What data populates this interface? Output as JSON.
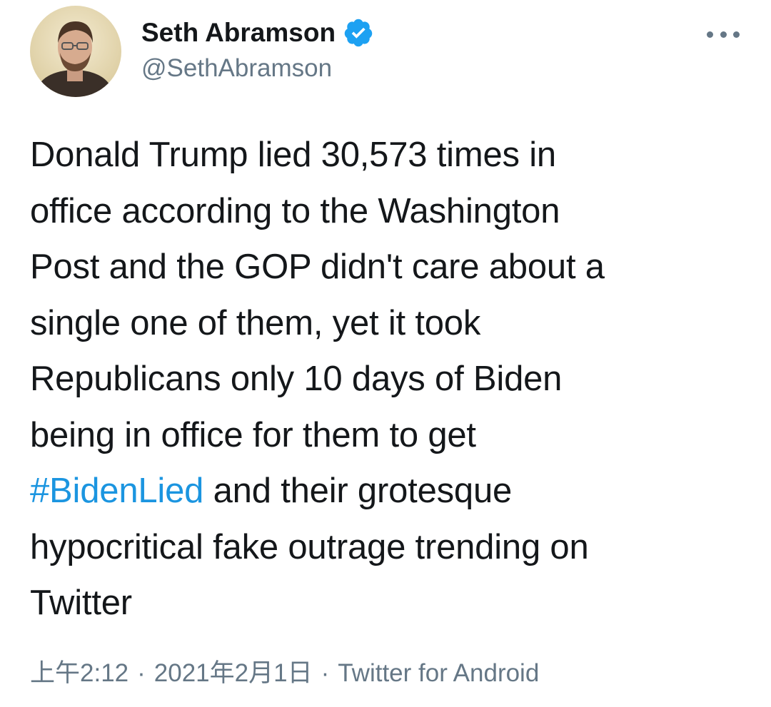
{
  "tweet": {
    "author": {
      "name": "Seth Abramson",
      "handle": "@SethAbramson",
      "verified": true,
      "avatar_icon": "avatar-photo"
    },
    "more_icon": "more-horizontal-icon",
    "text_lines": [
      "Donald Trump lied 30,573 times in",
      "office according to the Washington",
      "Post and the GOP didn't care about a",
      "single one of them, yet it took",
      "Republicans only 10 days of Biden",
      "being in office for them to get"
    ],
    "hashtag": "#BidenLied",
    "line_after_hashtag": " and their grotesque",
    "text_lines_end": [
      "hypocritical fake outrage trending on",
      "Twitter"
    ],
    "meta": {
      "time": "上午2:12",
      "separator": "·",
      "date": "2021年2月1日",
      "source": "Twitter for Android"
    },
    "colors": {
      "link": "#1b95e0",
      "secondary_text": "#657786",
      "verified_badge": "#1da1f2"
    }
  }
}
